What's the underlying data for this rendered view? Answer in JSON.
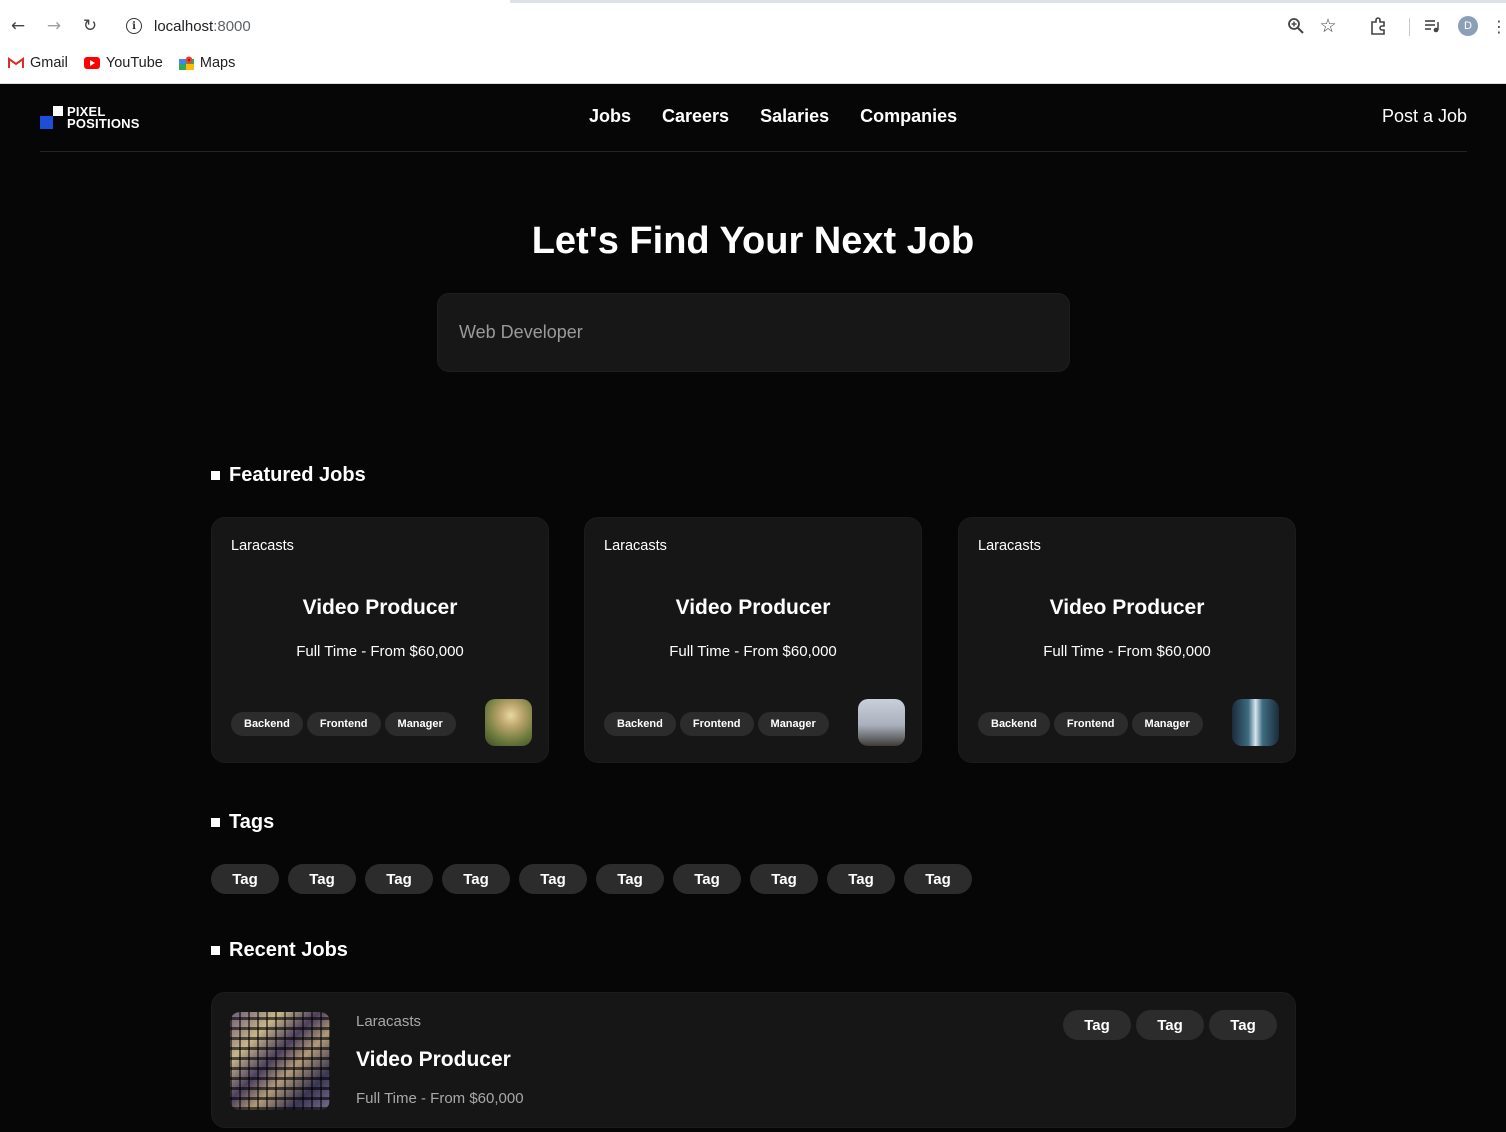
{
  "browser": {
    "url_host": "localhost",
    "url_port": ":8000",
    "profile_initial": "D",
    "bookmarks": [
      {
        "label": "Gmail",
        "icon": "gmail-icon"
      },
      {
        "label": "YouTube",
        "icon": "youtube-icon"
      },
      {
        "label": "Maps",
        "icon": "maps-icon"
      }
    ]
  },
  "site": {
    "logo_line1": "PIXEL",
    "logo_line2": "POSITIONS",
    "nav": [
      "Jobs",
      "Careers",
      "Salaries",
      "Companies"
    ],
    "post_job": "Post a Job",
    "hero_title": "Let's Find Your Next Job",
    "search_placeholder": "Web Developer",
    "featured_heading": "Featured Jobs",
    "featured_jobs": [
      {
        "company": "Laracasts",
        "title": "Video Producer",
        "salary": "Full Time - From $60,000",
        "tags": [
          "Backend",
          "Frontend",
          "Manager"
        ]
      },
      {
        "company": "Laracasts",
        "title": "Video Producer",
        "salary": "Full Time - From $60,000",
        "tags": [
          "Backend",
          "Frontend",
          "Manager"
        ]
      },
      {
        "company": "Laracasts",
        "title": "Video Producer",
        "salary": "Full Time - From $60,000",
        "tags": [
          "Backend",
          "Frontend",
          "Manager"
        ]
      }
    ],
    "tags_heading": "Tags",
    "tags": [
      "Tag",
      "Tag",
      "Tag",
      "Tag",
      "Tag",
      "Tag",
      "Tag",
      "Tag",
      "Tag",
      "Tag"
    ],
    "recent_heading": "Recent Jobs",
    "recent_jobs": [
      {
        "company": "Laracasts",
        "title": "Video Producer",
        "salary": "Full Time - From $60,000",
        "tags": [
          "Tag",
          "Tag",
          "Tag"
        ]
      }
    ]
  },
  "colors": {
    "page_bg": "#060606",
    "card_bg": "#161616",
    "pill_bg": "#2c2c2c",
    "logo_blue": "#1d4ed8"
  }
}
